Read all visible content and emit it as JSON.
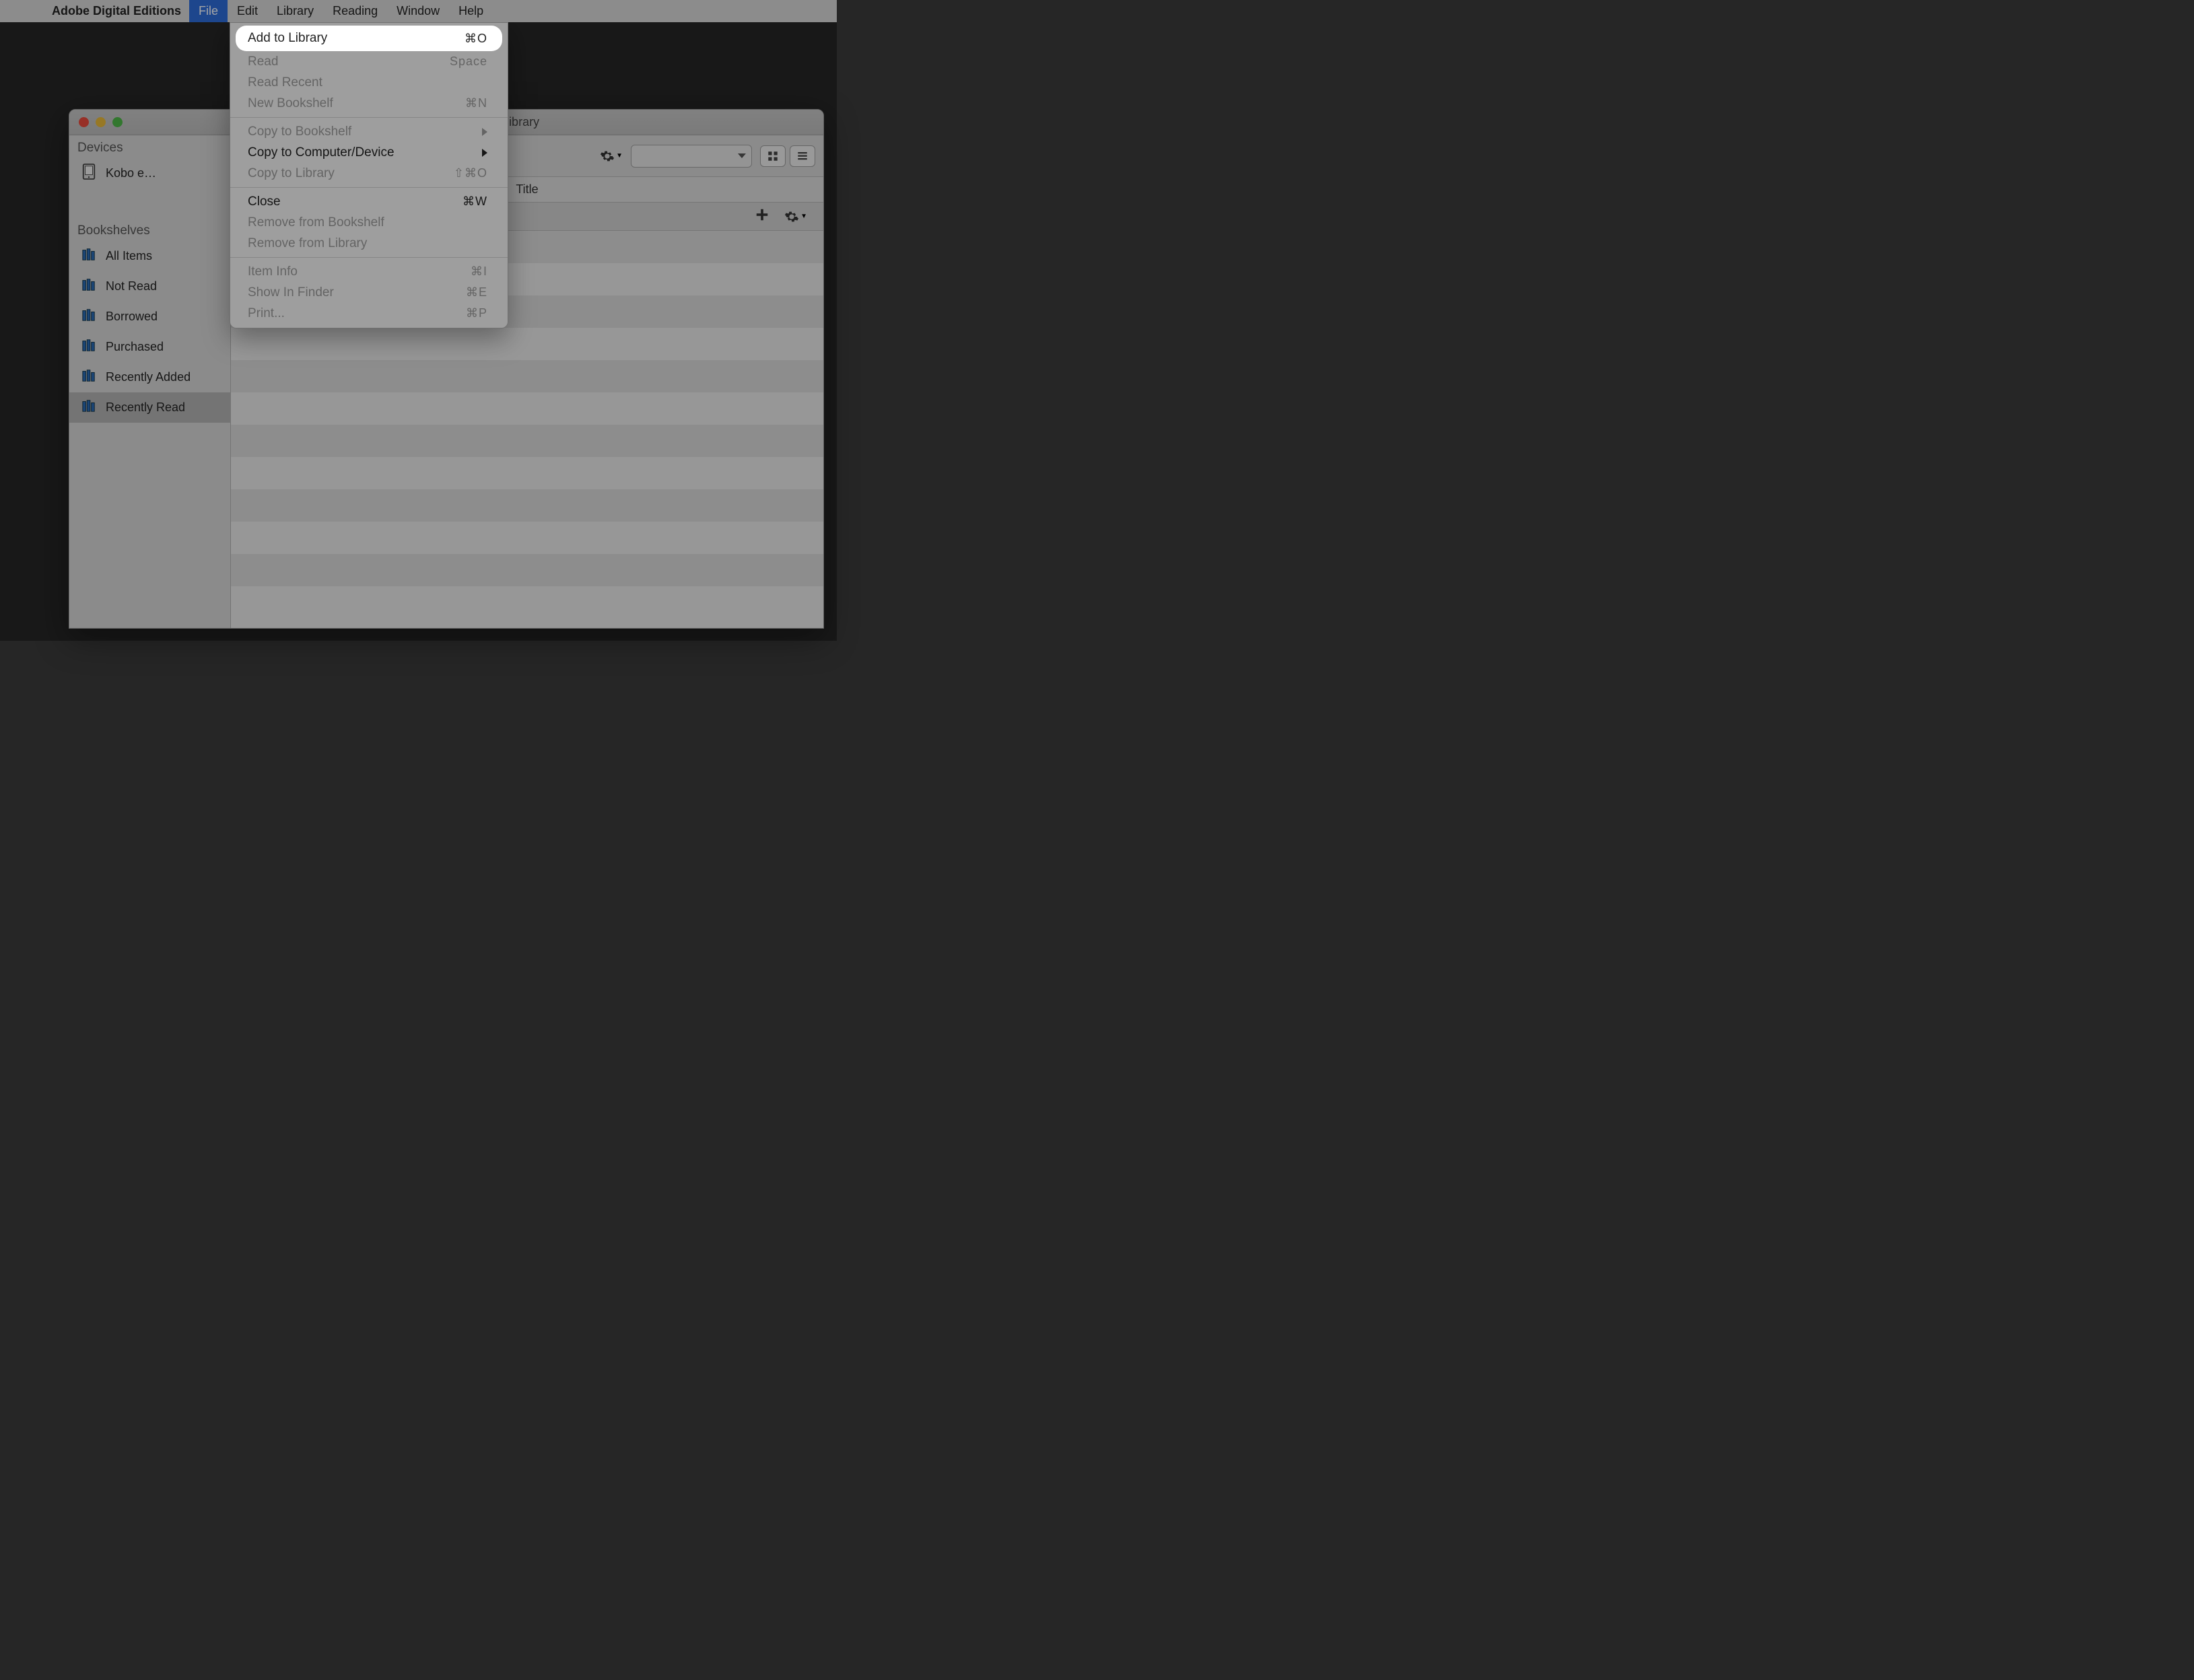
{
  "menubar": {
    "app_name": "Adobe Digital Editions",
    "items": [
      "File",
      "Edit",
      "Library",
      "Reading",
      "Window",
      "Help"
    ],
    "selected": "File"
  },
  "dropdown": {
    "groups": [
      [
        {
          "label": "Add to Library",
          "shortcut": "⌘O",
          "enabled": true,
          "highlight": true
        },
        {
          "label": "Read",
          "shortcut": "Space",
          "enabled": false
        },
        {
          "label": "Read Recent",
          "shortcut": "",
          "enabled": false
        },
        {
          "label": "New Bookshelf",
          "shortcut": "⌘N",
          "enabled": false
        }
      ],
      [
        {
          "label": "Copy to Bookshelf",
          "shortcut": "",
          "enabled": false,
          "submenu": true
        },
        {
          "label": "Copy to Computer/Device",
          "shortcut": "",
          "enabled": true,
          "submenu": true
        },
        {
          "label": "Copy to Library",
          "shortcut": "⇧⌘O",
          "enabled": false
        }
      ],
      [
        {
          "label": "Close",
          "shortcut": "⌘W",
          "enabled": true
        },
        {
          "label": "Remove from Bookshelf",
          "shortcut": "",
          "enabled": false
        },
        {
          "label": "Remove from Library",
          "shortcut": "",
          "enabled": false
        }
      ],
      [
        {
          "label": "Item Info",
          "shortcut": "⌘I",
          "enabled": false
        },
        {
          "label": "Show In Finder",
          "shortcut": "⌘E",
          "enabled": false
        },
        {
          "label": "Print...",
          "shortcut": "⌘P",
          "enabled": false
        }
      ]
    ]
  },
  "window": {
    "title_suffix": "ibrary"
  },
  "sidebar": {
    "devices_header": "Devices",
    "devices": [
      {
        "label": "Kobo e…"
      }
    ],
    "bookshelves_header": "Bookshelves",
    "bookshelves": [
      {
        "label": "All Items"
      },
      {
        "label": "Not Read"
      },
      {
        "label": "Borrowed"
      },
      {
        "label": "Purchased"
      },
      {
        "label": "Recently Added"
      },
      {
        "label": "Recently Read",
        "selected": true
      }
    ]
  },
  "content": {
    "column_header": "Title"
  }
}
